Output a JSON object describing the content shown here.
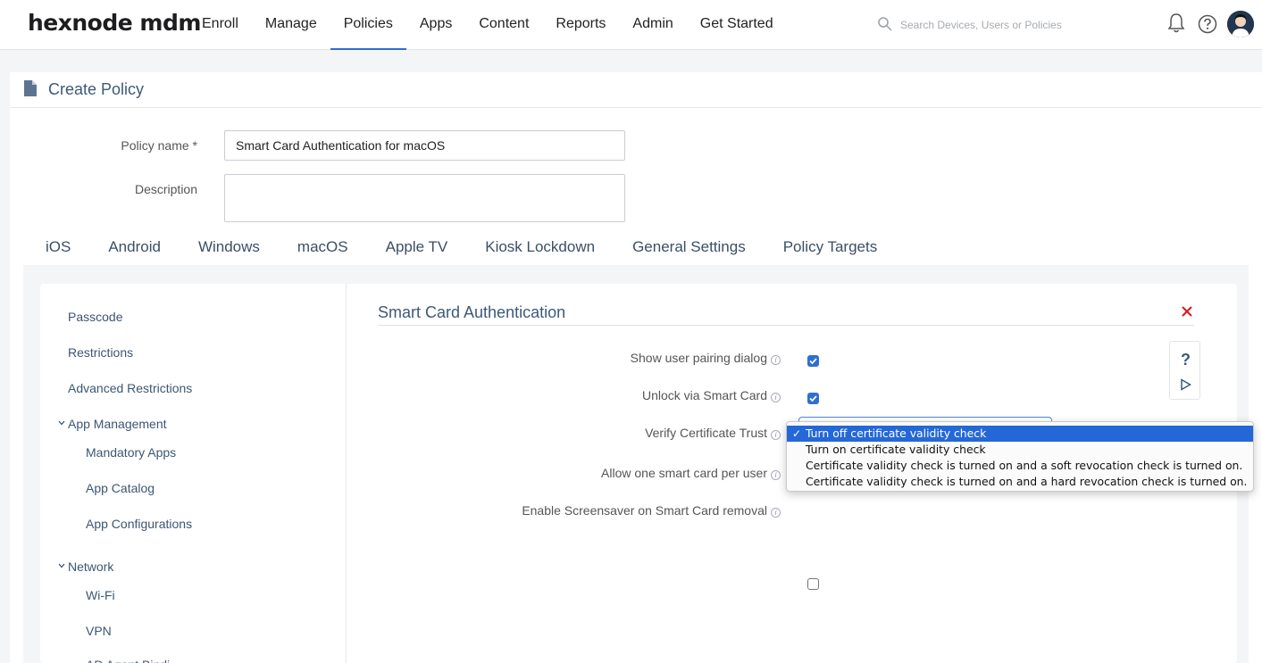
{
  "app": {
    "logo": "hexnode mdm"
  },
  "nav": {
    "items": [
      "Enroll",
      "Manage",
      "Policies",
      "Apps",
      "Content",
      "Reports",
      "Admin",
      "Get Started"
    ],
    "active": "Policies"
  },
  "search": {
    "placeholder": "Search Devices, Users or Policies"
  },
  "page": {
    "title": "Create Policy"
  },
  "form": {
    "policy_name_label": "Policy name *",
    "policy_name_value": "Smart Card Authentication for macOS",
    "description_label": "Description",
    "description_value": ""
  },
  "tabs": [
    "iOS",
    "Android",
    "Windows",
    "macOS",
    "Apple TV",
    "Kiosk Lockdown",
    "General Settings",
    "Policy Targets"
  ],
  "active_tab": "macOS",
  "sidebar": {
    "items": [
      "Passcode",
      "Restrictions",
      "Advanced Restrictions",
      "App Management",
      "Mandatory Apps",
      "App Catalog",
      "App Configurations",
      "Network",
      "Wi-Fi",
      "VPN",
      "AD Agent Bindi..."
    ]
  },
  "section": {
    "title": "Smart Card Authentication",
    "options": [
      {
        "label": "Show user pairing dialog",
        "checked": true
      },
      {
        "label": "Unlock via Smart Card",
        "checked": true
      },
      {
        "label": "Verify Certificate Trust"
      },
      {
        "label": "Allow one smart card per user"
      },
      {
        "label": "Enable Screensaver on Smart Card removal",
        "checked": false
      }
    ]
  },
  "dropdown": {
    "selected_mark": "✓",
    "options": [
      "Turn off certificate validity check",
      "Turn on certificate validity check",
      "Certificate validity check is turned on and a soft revocation check is turned on.",
      "Certificate validity check is turned on and a hard revocation check is turned on."
    ],
    "selected_index": 0
  },
  "side_help": {
    "help_glyph": "?"
  },
  "colors": {
    "accent": "#2f6fd1",
    "title": "#3c5a7a",
    "menu_selected": "#2468d8",
    "close": "#d61f26"
  }
}
